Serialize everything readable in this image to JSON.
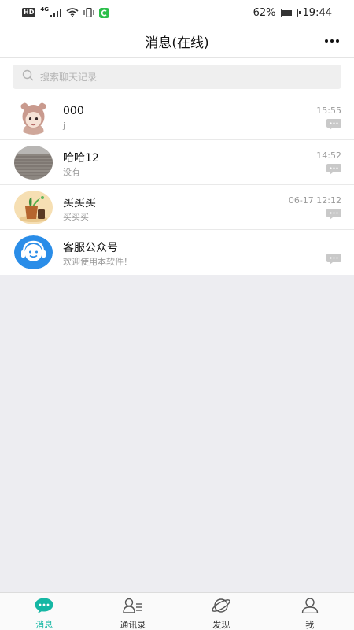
{
  "status_bar": {
    "network_badge": "HD",
    "signal_label": "4G",
    "battery_percent": "62%",
    "time": "19:44"
  },
  "header": {
    "title": "消息(在线)",
    "more_icon": "more-icon"
  },
  "search": {
    "placeholder": "搜索聊天记录",
    "icon": "search-icon"
  },
  "chats": [
    {
      "name": "000",
      "preview": "j",
      "time": "15:55",
      "avatar": "avatar-cartoon-girl"
    },
    {
      "name": "哈哈12",
      "preview": "没有",
      "time": "14:52",
      "avatar": "avatar-wood-texture"
    },
    {
      "name": "买买买",
      "preview": "买买买",
      "time": "06-17 12:12",
      "avatar": "avatar-plant-pot"
    },
    {
      "name": "客服公众号",
      "preview": "欢迎使用本软件！",
      "time": "",
      "avatar": "avatar-customer-service"
    }
  ],
  "tabs": [
    {
      "label": "消息",
      "icon": "chat-bubble-icon",
      "active": true
    },
    {
      "label": "通讯录",
      "icon": "contacts-icon",
      "active": false
    },
    {
      "label": "发现",
      "icon": "planet-icon",
      "active": false
    },
    {
      "label": "我",
      "icon": "user-icon",
      "active": false
    }
  ],
  "colors": {
    "accent": "#16b7a4",
    "customer_service_blue": "#2a8de8",
    "background": "#ededf1"
  }
}
